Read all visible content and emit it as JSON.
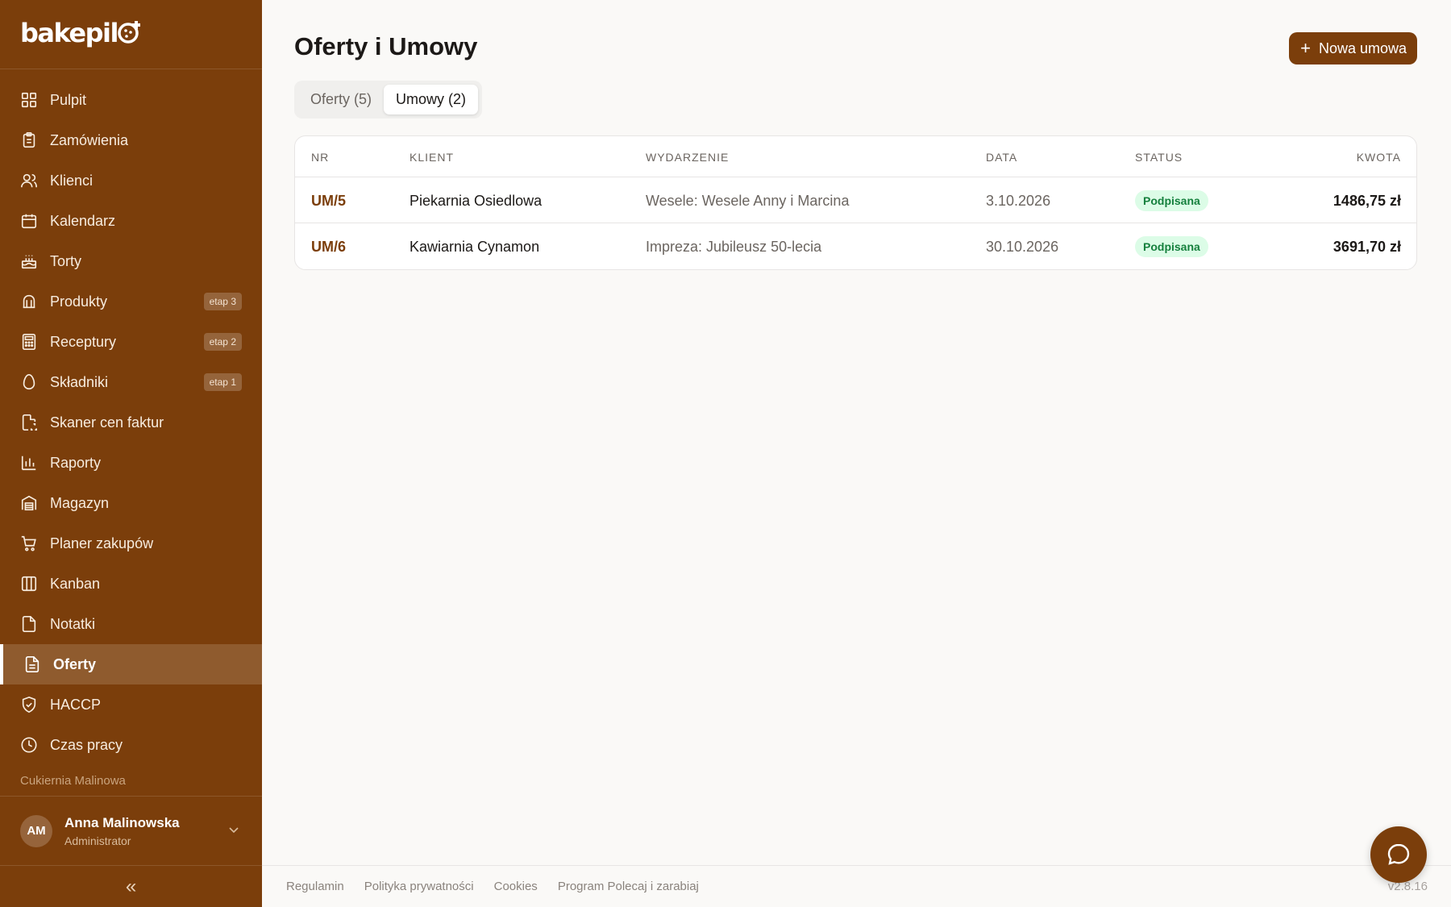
{
  "brand": {
    "name": "bakepil"
  },
  "sidebar": {
    "items": [
      {
        "label": "Pulpit",
        "icon": "dashboard-icon"
      },
      {
        "label": "Zamówienia",
        "icon": "clipboard-icon"
      },
      {
        "label": "Klienci",
        "icon": "users-icon"
      },
      {
        "label": "Kalendarz",
        "icon": "calendar-icon"
      },
      {
        "label": "Torty",
        "icon": "cake-icon"
      },
      {
        "label": "Produkty",
        "icon": "croissant-icon",
        "badge": "etap 3"
      },
      {
        "label": "Receptury",
        "icon": "calculator-icon",
        "badge": "etap 2"
      },
      {
        "label": "Składniki",
        "icon": "egg-icon",
        "badge": "etap 1"
      },
      {
        "label": "Skaner cen faktur",
        "icon": "scan-document-icon"
      },
      {
        "label": "Raporty",
        "icon": "bar-chart-icon"
      },
      {
        "label": "Magazyn",
        "icon": "warehouse-icon"
      },
      {
        "label": "Planer zakupów",
        "icon": "cart-icon"
      },
      {
        "label": "Kanban",
        "icon": "columns-icon"
      },
      {
        "label": "Notatki",
        "icon": "note-icon"
      },
      {
        "label": "Oferty",
        "icon": "document-icon",
        "active": true
      },
      {
        "label": "HACCP",
        "icon": "shield-check-icon"
      },
      {
        "label": "Czas pracy",
        "icon": "clock-icon"
      }
    ],
    "org_name": "Cukiernia Malinowa",
    "user": {
      "initials": "AM",
      "name": "Anna Malinowska",
      "role": "Administrator"
    },
    "collapse_glyph": "«"
  },
  "main": {
    "title": "Oferty i Umowy",
    "new_button_label": "Nowa umowa",
    "tabs": [
      {
        "label": "Oferty (5)",
        "active": false
      },
      {
        "label": "Umowy (2)",
        "active": true
      }
    ],
    "table": {
      "headers": {
        "nr": "NR",
        "klient": "KLIENT",
        "wydarzenie": "WYDARZENIE",
        "data": "DATA",
        "status": "STATUS",
        "kwota": "KWOTA"
      },
      "rows": [
        {
          "nr": "UM/5",
          "klient": "Piekarnia Osiedlowa",
          "wydarzenie": "Wesele: Wesele Anny i Marcina",
          "data": "3.10.2026",
          "status": "Podpisana",
          "kwota": "1486,75 zł"
        },
        {
          "nr": "UM/6",
          "klient": "Kawiarnia Cynamon",
          "wydarzenie": "Impreza: Jubileusz 50-lecia",
          "data": "30.10.2026",
          "status": "Podpisana",
          "kwota": "3691,70 zł"
        }
      ]
    }
  },
  "footer": {
    "links": [
      "Regulamin",
      "Polityka prywatności",
      "Cookies",
      "Program Polecaj i zarabiaj"
    ],
    "version": "v2.8.16"
  },
  "colors": {
    "sidebar_bg": "#7b3e0b",
    "active_item_bg": "#8f5b2e",
    "accent": "#7b3e0b",
    "status_bg": "#dcfce7",
    "status_text": "#15803d"
  }
}
